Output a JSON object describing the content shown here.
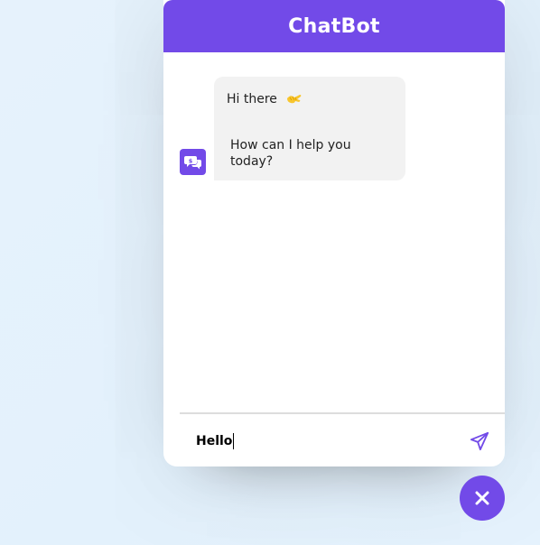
{
  "header": {
    "title": "ChatBot"
  },
  "messages": [
    {
      "sender": "bot",
      "avatar_icon": "chat-bubbles-icon",
      "line1": "Hi there",
      "emoji": "waving-hand-emoji",
      "line2": "How can I help you today?"
    }
  ],
  "input": {
    "value": "Hello"
  },
  "send": {
    "icon": "send-icon"
  },
  "toggler": {
    "icon": "close-icon"
  },
  "colors": {
    "accent": "#724AE8",
    "page_background": "#E3F2FD",
    "bubble_background": "#F2F2F2",
    "emoji": "#F8C62E"
  }
}
